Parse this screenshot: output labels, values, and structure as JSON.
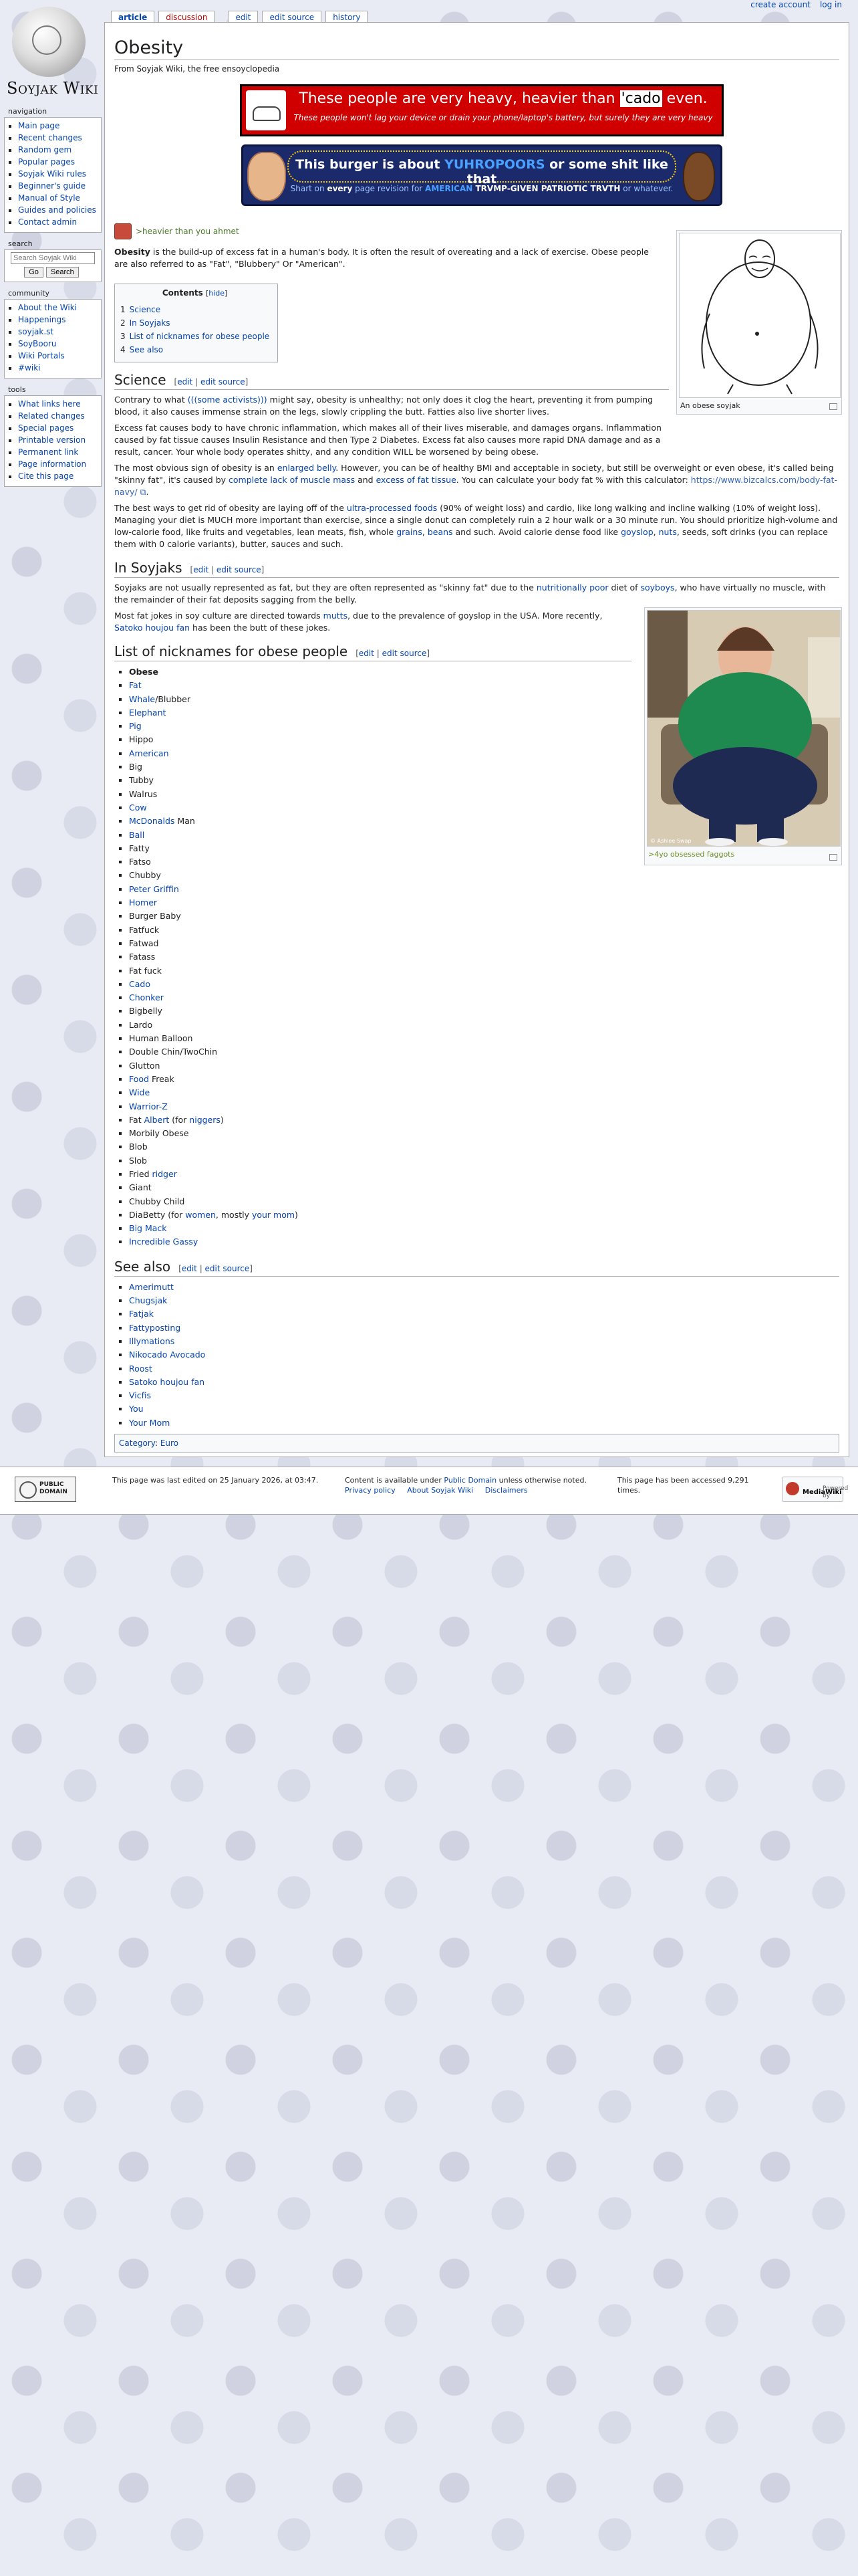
{
  "personal_tools": {
    "create_account": "create account",
    "log_in": "log in"
  },
  "site": {
    "name": "Soyjak Wiki"
  },
  "tabs": [
    {
      "label": "article"
    },
    {
      "label": "discussion"
    },
    {
      "label": "edit"
    },
    {
      "label": "edit source"
    },
    {
      "label": "history"
    }
  ],
  "sidebar": {
    "navigation": {
      "title": "navigation",
      "items": [
        "Main page",
        "Recent changes",
        "Random gem",
        "Popular pages",
        "Soyjak Wiki rules",
        "Beginner's guide",
        "Manual of Style",
        "Guides and policies",
        "Contact admin"
      ]
    },
    "search": {
      "title": "search",
      "placeholder": "Search Soyjak Wiki",
      "go": "Go",
      "search": "Search"
    },
    "community": {
      "title": "community",
      "items": [
        "About the Wiki",
        "Happenings",
        "soyjak.st",
        "SoyBooru",
        "Wiki Portals",
        "#wiki"
      ]
    },
    "tools": {
      "title": "tools",
      "items": [
        "What links here",
        "Related changes",
        "Special pages",
        "Printable version",
        "Permanent link",
        "Page information",
        "Cite this page"
      ]
    }
  },
  "page": {
    "title": "Obesity",
    "tagline": "From Soyjak Wiki, the free ensoyclopedia"
  },
  "banners": {
    "red": {
      "line1_a": "These people are very heavy, heavier than ",
      "line1_hl": "'cado",
      "line1_b": " even.",
      "line2": "These people won't lag your device or drain your phone/laptop's battery, but surely they are very heavy"
    },
    "blue": {
      "line1_a": "This burger is about ",
      "line1_hl": "YUHROPOORS",
      "line1_b": " or some shit like that",
      "line2_a": "Shart on ",
      "line2_every": "every",
      "line2_b": " page revision for ",
      "line2_hl": "AMERICAN",
      "line2_c": " TRVMP-GIVEN PATRIOTIC TRVTH",
      "line2_d": " or whatever."
    }
  },
  "hatnote": {
    "text": ">heavier than you ahmet"
  },
  "intro": {
    "bold": "Obesity",
    "rest": " is the build-up of excess fat in a human's body. It is often the result of overeating and a lack of exercise. Obese people are also referred to as \"Fat\", \"Blubbery\" Or \"American\"."
  },
  "toc": {
    "title": "Contents",
    "hide_open": "[",
    "hide": "hide",
    "hide_close": "]",
    "items": [
      {
        "num": "1",
        "label": "Science"
      },
      {
        "num": "2",
        "label": "In Soyjaks"
      },
      {
        "num": "3",
        "label": "List of nicknames for obese people"
      },
      {
        "num": "4",
        "label": "See also"
      }
    ]
  },
  "edit_links": {
    "open": "[",
    "edit": "edit",
    "sep": " | ",
    "edit_source": "edit source",
    "close": "]"
  },
  "science": {
    "heading": "Science",
    "p1_a": "Contrary to what ",
    "p1_link": "(((some activists)))",
    "p1_b": " might say, obesity is unhealthy; not only does it clog the heart, preventing it from pumping blood, it also causes immense strain on the legs, slowly crippling the butt. Fatties also live shorter lives.",
    "p2": "Excess fat causes body to have chronic inflammation, which makes all of their lives miserable, and damages organs. Inflammation caused by fat tissue causes Insulin Resistance and then Type 2 Diabetes. Excess fat also causes more rapid DNA damage and as a result, cancer. Your whole body operates shitty, and any condition WILL be worsened by being obese.",
    "p3_a": "The most obvious sign of obesity is an ",
    "p3_link1": "enlarged belly",
    "p3_b": ". However, you can be of healthy BMI and acceptable in society, but still be overweight or even obese, it's called being \"skinny fat\", it's caused by ",
    "p3_link2": "complete lack of muscle mass",
    "p3_c": " and ",
    "p3_link3": "excess of fat tissue",
    "p3_d": ". You can calculate your body fat % with this calculator: ",
    "p3_ext": "https://www.bizcalcs.com/body-fat-navy/",
    "p3_e": ".",
    "p4_a": "The best ways to get rid of obesity are laying off of the ",
    "p4_link1": "ultra-processed foods",
    "p4_b": " (90% of weight loss) and cardio, like long walking and incline walking (10% of weight loss). Managing your diet is MUCH more important than exercise, since a single donut can completely ruin a 2 hour walk or a 30 minute run. You should prioritize high-volume and low-calorie food, like fruits and vegetables, lean meats, fish, whole ",
    "p4_link2": "grains",
    "p4_c": ", ",
    "p4_link3": "beans",
    "p4_d": " and such. Avoid calorie dense food like ",
    "p4_link4": "goyslop",
    "p4_e": ", ",
    "p4_link5": "nuts",
    "p4_f": ", seeds, soft drinks (you can replace them with 0 calorie variants), butter, sauces and such."
  },
  "in_soyjaks": {
    "heading": "In Soyjaks",
    "p1_a": "Soyjaks are not usually represented as fat, but they are often represented as \"skinny fat\" due to the ",
    "p1_link1": "nutritionally poor",
    "p1_b": " diet of ",
    "p1_link2": "soyboys",
    "p1_c": ", who have virtually no muscle, with the remainder of their fat deposits sagging from the belly.",
    "p2_a": "Most fat jokes in soy culture are directed towards ",
    "p2_link1": "mutts",
    "p2_b": ", due to the prevalence of goyslop in the USA. More recently, ",
    "p2_link2": "Satoko houjou fan",
    "p2_c": " has been the butt of these jokes."
  },
  "nicknames": {
    "heading": "List of nicknames for obese people",
    "items": [
      {
        "text": "Obese",
        "type": "bold"
      },
      {
        "text": "Fat",
        "type": "link"
      },
      {
        "parts": [
          {
            "text": "Whale",
            "type": "link"
          },
          {
            "text": "/Blubber",
            "type": "text"
          }
        ]
      },
      {
        "text": "Elephant",
        "type": "link"
      },
      {
        "text": "Pig",
        "type": "link"
      },
      {
        "text": "Hippo",
        "type": "text"
      },
      {
        "text": "American",
        "type": "link"
      },
      {
        "text": "Big",
        "type": "text"
      },
      {
        "text": "Tubby",
        "type": "text"
      },
      {
        "text": "Walrus",
        "type": "text"
      },
      {
        "text": "Cow",
        "type": "link"
      },
      {
        "parts": [
          {
            "text": "McDonalds",
            "type": "link"
          },
          {
            "text": " Man",
            "type": "text"
          }
        ]
      },
      {
        "text": "Ball",
        "type": "link"
      },
      {
        "text": "Fatty",
        "type": "text"
      },
      {
        "text": "Fatso",
        "type": "text"
      },
      {
        "text": "Chubby",
        "type": "text"
      },
      {
        "text": "Peter Griffin",
        "type": "link"
      },
      {
        "text": "Homer",
        "type": "link"
      },
      {
        "text": "Burger Baby",
        "type": "text"
      },
      {
        "text": "Fatfuck",
        "type": "text"
      },
      {
        "text": "Fatwad",
        "type": "text"
      },
      {
        "text": "Fatass",
        "type": "text"
      },
      {
        "text": "Fat fuck",
        "type": "text"
      },
      {
        "text": "Cado",
        "type": "link"
      },
      {
        "text": "Chonker",
        "type": "link"
      },
      {
        "text": "Bigbelly",
        "type": "text"
      },
      {
        "text": "Lardo",
        "type": "text"
      },
      {
        "text": "Human Balloon",
        "type": "text"
      },
      {
        "text": "Double Chin/TwoChin",
        "type": "text"
      },
      {
        "text": "Glutton",
        "type": "text"
      },
      {
        "parts": [
          {
            "text": "Food",
            "type": "link"
          },
          {
            "text": " Freak",
            "type": "text"
          }
        ]
      },
      {
        "text": "Wide",
        "type": "link"
      },
      {
        "text": "Warrior-Z",
        "type": "link"
      },
      {
        "parts": [
          {
            "text": "Fat ",
            "type": "text"
          },
          {
            "text": "Albert",
            "type": "link"
          },
          {
            "text": " (for ",
            "type": "text"
          },
          {
            "text": "niggers",
            "type": "link"
          },
          {
            "text": ")",
            "type": "text"
          }
        ]
      },
      {
        "text": "Morbily Obese",
        "type": "text"
      },
      {
        "text": "Blob",
        "type": "text"
      },
      {
        "text": "Slob",
        "type": "text"
      },
      {
        "parts": [
          {
            "text": "Fried ",
            "type": "text"
          },
          {
            "text": "ridger",
            "type": "link"
          }
        ]
      },
      {
        "text": "Giant",
        "type": "text"
      },
      {
        "text": "Chubby Child",
        "type": "text"
      },
      {
        "parts": [
          {
            "text": "DiaBetty (for ",
            "type": "text"
          },
          {
            "text": "women",
            "type": "link"
          },
          {
            "text": ", mostly ",
            "type": "text"
          },
          {
            "text": "your mom",
            "type": "link"
          },
          {
            "text": ")",
            "type": "text"
          }
        ]
      },
      {
        "text": "Big Mack",
        "type": "link"
      },
      {
        "text": "Incredible Gassy",
        "type": "link"
      }
    ]
  },
  "see_also": {
    "heading": "See also",
    "items": [
      "Amerimutt",
      "Chugsjak",
      "Fatjak",
      "Fattyposting",
      "Illymations",
      "Nikocado Avocado",
      "Roost",
      "Satoko houjou fan",
      "Vicfis",
      "You",
      "Your Mom"
    ]
  },
  "thumbs": {
    "soyjak": {
      "caption": "An obese soyjak"
    },
    "photo": {
      "caption": ">4yo obsessed faggots",
      "watermark": "© Ashlee Swap"
    }
  },
  "categories": {
    "label": "Category",
    "items": [
      "Euro"
    ]
  },
  "footer": {
    "last_edited": "This page was last edited on 25 January 2026, at 03:47.",
    "content_a": "Content is available under ",
    "content_link": "Public Domain",
    "content_b": " unless otherwise noted.",
    "accessed": "This page has been accessed 9,291 times.",
    "privacy": "Privacy policy",
    "about": "About Soyjak Wiki",
    "disclaimers": "Disclaimers",
    "pd_badge": "PUBLIC DOMAIN",
    "mw_line1": "Powered by",
    "mw_line2": "MediaWiki"
  },
  "colors": {
    "link": "#0645ad",
    "new_link": "#ba0000",
    "red_banner": "#d10000",
    "blue_banner": "#1b2a6b"
  }
}
